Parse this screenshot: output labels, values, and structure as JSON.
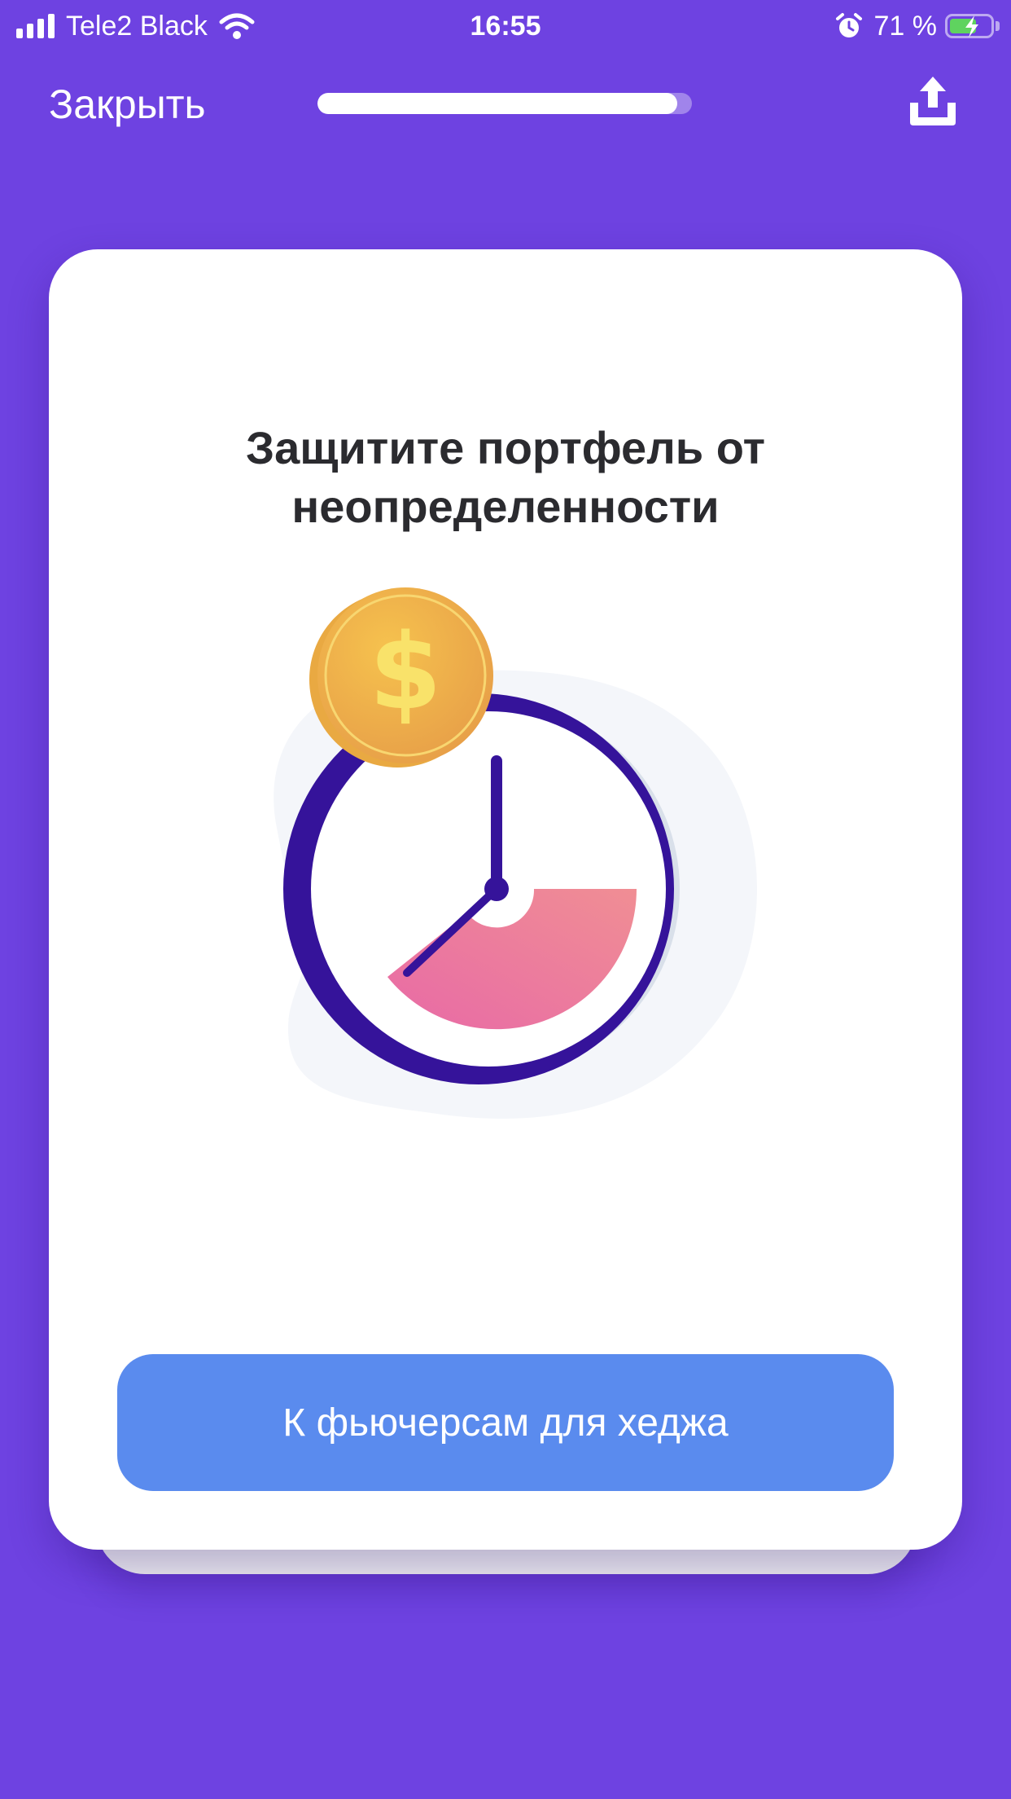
{
  "status_bar": {
    "carrier": "Tele2 Black",
    "time": "16:55",
    "battery_percent": "71 %",
    "battery_level": 0.71,
    "icons": [
      "signal-icon",
      "wifi-icon",
      "alarm-icon",
      "battery-charging-icon"
    ]
  },
  "header": {
    "close_label": "Закрыть",
    "progress": 0.96,
    "share_icon": "share-upload-icon"
  },
  "card": {
    "title": "Защитите портфель от неопределенности",
    "illustration": "clock-with-dollar-coin",
    "cta_label": "К фьючерсам для хеджа"
  },
  "colors": {
    "background": "#6E42E1",
    "card": "#FFFFFF",
    "cta": "#5A8BEE",
    "title_text": "#2B2B2F",
    "coin": "#F2C14E",
    "clock_ring": "#35139A",
    "clock_segment": "#EA6FA4"
  }
}
